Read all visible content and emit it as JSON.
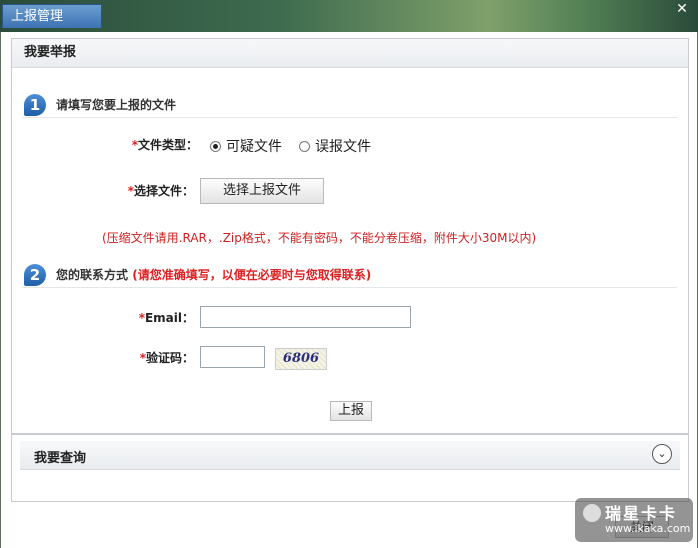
{
  "window": {
    "tab_title": "上报管理",
    "close_label": "✕",
    "close_button": "关闭"
  },
  "report": {
    "heading": "我要举报",
    "step1": {
      "number": "1",
      "title": "请填写您要上报的文件",
      "file_type_required": "*",
      "file_type_label": "文件类型：",
      "options": [
        "可疑文件",
        "误报文件"
      ],
      "selected": "可疑文件",
      "choose_required": "*",
      "choose_label": "选择文件：",
      "choose_button": "选择上报文件",
      "note": "(压缩文件请用.RAR，.Zip格式，不能有密码，不能分卷压缩，附件大小30M以内)"
    },
    "step2": {
      "number": "2",
      "title": "您的联系方式",
      "hint": "(请您准确填写，以便在必要时与您取得联系)",
      "email_required": "*",
      "email_label": "Email：",
      "email_value": "",
      "captcha_required": "*",
      "captcha_label": "验证码：",
      "captcha_value": "",
      "captcha_text": "6806"
    },
    "submit_button": "上报"
  },
  "query": {
    "heading": "我要查询",
    "expand_icon": "chevron-down-icon"
  },
  "watermark": {
    "brand": "瑞星卡卡",
    "url": "www.ikaka.com"
  }
}
